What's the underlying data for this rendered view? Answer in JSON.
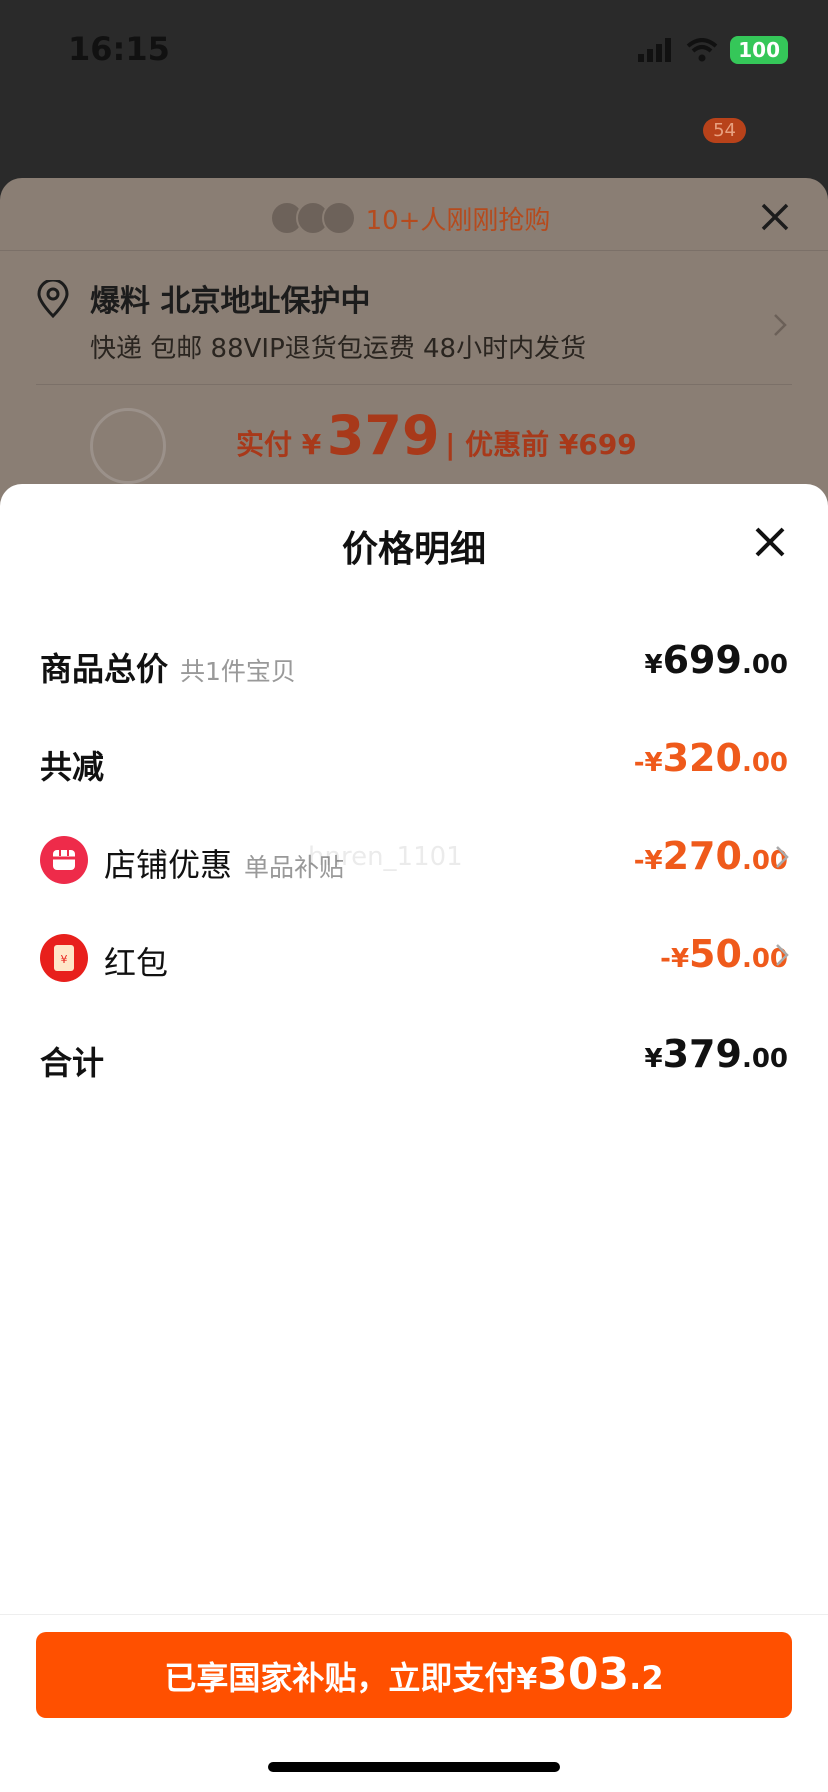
{
  "status_bar": {
    "time": "16:15",
    "battery": "100"
  },
  "background": {
    "badge": "54",
    "social_proof": "10+人刚刚抢购",
    "address_title": "爆料 北京地址保护中",
    "address_sub": "快递 包邮 88VIP退货包运费 48小时内发货",
    "price_label": "实付 ¥",
    "price_value": "379",
    "price_before": "| 优惠前 ¥699"
  },
  "sheet": {
    "title": "价格明细",
    "rows": [
      {
        "label": "商品总价",
        "sub": "共1件宝贝",
        "currency": "¥",
        "int": "699",
        "dec": ".00"
      },
      {
        "label": "共减",
        "currency": "-¥",
        "int": "320",
        "dec": ".00"
      },
      {
        "label": "店铺优惠",
        "sub": "单品补贴",
        "currency": "-¥",
        "int": "270",
        "dec": ".00",
        "icon": "shop-icon"
      },
      {
        "label": "红包",
        "currency": "-¥",
        "int": "50",
        "dec": ".00",
        "icon": "red-packet-icon"
      },
      {
        "label": "合计",
        "currency": "¥",
        "int": "379",
        "dec": ".00"
      }
    ],
    "watermark": "hnren_1101"
  },
  "pay_button": {
    "text": "已享国家补贴，立即支付",
    "currency": "¥",
    "int": "303",
    "dec": ".2"
  },
  "colors": {
    "accent": "#ff5000",
    "discount": "#ef5a1b"
  }
}
